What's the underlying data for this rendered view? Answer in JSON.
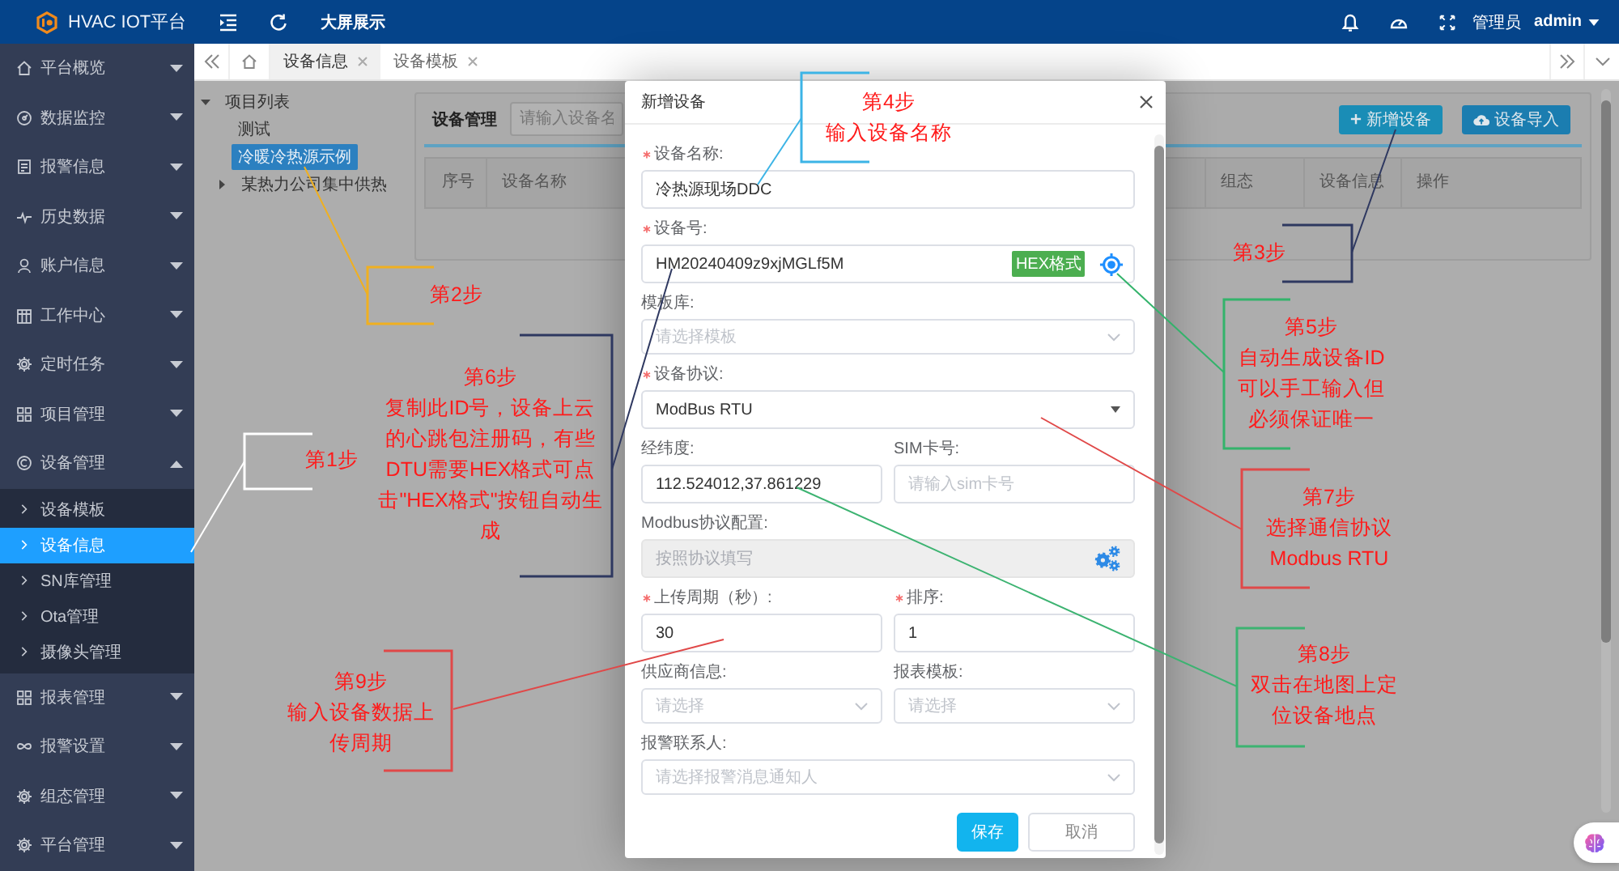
{
  "header": {
    "title": "HVAC IOT平台",
    "link": "大屏展示",
    "role": "管理员",
    "user": "admin"
  },
  "sidebar": {
    "items": [
      {
        "label": "平台概览",
        "expanded": false
      },
      {
        "label": "数据监控",
        "expanded": false
      },
      {
        "label": "报警信息",
        "expanded": false
      },
      {
        "label": "历史数据",
        "expanded": false
      },
      {
        "label": "账户信息",
        "expanded": false
      },
      {
        "label": "工作中心",
        "expanded": false
      },
      {
        "label": "定时任务",
        "expanded": false
      },
      {
        "label": "项目管理",
        "expanded": false
      },
      {
        "label": "设备管理",
        "expanded": true,
        "children": [
          {
            "label": "设备模板",
            "selected": false
          },
          {
            "label": "设备信息",
            "selected": true
          },
          {
            "label": "SN库管理",
            "selected": false
          },
          {
            "label": "Ota管理",
            "selected": false
          },
          {
            "label": "摄像头管理",
            "selected": false
          }
        ]
      },
      {
        "label": "报表管理",
        "expanded": false
      },
      {
        "label": "报警设置",
        "expanded": false
      },
      {
        "label": "组态管理",
        "expanded": false
      },
      {
        "label": "平台管理",
        "expanded": false
      }
    ]
  },
  "tabs": [
    {
      "label": "设备信息",
      "selected": true
    },
    {
      "label": "设备模板",
      "selected": false
    }
  ],
  "project_tree": {
    "items": [
      {
        "label": "项目列表",
        "kind": "folder",
        "expanded": true,
        "selected": false,
        "children": [
          {
            "label": "测试",
            "kind": "leaf",
            "selected": false
          },
          {
            "label": "冷暖冷热源示例",
            "kind": "leaf",
            "selected": true
          },
          {
            "label": "某热力公司集中供热",
            "kind": "folder",
            "expanded": false,
            "selected": false
          }
        ]
      }
    ]
  },
  "device_panel": {
    "title": "设备管理",
    "search_placeholder": "请输入设备名",
    "buttons": [
      {
        "label": "新增设备",
        "kind": "add"
      },
      {
        "label": "设备导入",
        "kind": "import"
      }
    ],
    "table": {
      "columns": [
        "序号",
        "设备名称",
        "组态",
        "设备信息",
        "操作"
      ]
    }
  },
  "dialog": {
    "title": "新增设备",
    "rows": [
      {
        "fields": [
          {
            "label": "设备名称:",
            "required": true,
            "kind": "input",
            "value": "冷热源现场DDC"
          }
        ]
      },
      {
        "fields": [
          {
            "label": "设备号:",
            "required": true,
            "kind": "id-input",
            "value": "HM20240409z9xjMGLf5M",
            "badge": "HEX格式"
          }
        ]
      },
      {
        "fields": [
          {
            "label": "模板库:",
            "required": false,
            "kind": "select",
            "placeholder": "请选择模板"
          }
        ]
      },
      {
        "fields": [
          {
            "label": "设备协议:",
            "required": true,
            "kind": "dropdown",
            "value": "ModBus RTU"
          }
        ]
      },
      {
        "fields": [
          {
            "label": "经纬度:",
            "required": false,
            "kind": "input",
            "value": "112.524012,37.861229"
          },
          {
            "label": "SIM卡号:",
            "required": false,
            "kind": "input",
            "placeholder": "请输入sim卡号"
          }
        ]
      },
      {
        "fields": [
          {
            "label": "Modbus协议配置:",
            "required": false,
            "kind": "config",
            "placeholder": "按照协议填写"
          }
        ]
      },
      {
        "fields": [
          {
            "label": "上传周期（秒）:",
            "required": true,
            "kind": "input",
            "value": "30"
          },
          {
            "label": "排序:",
            "required": true,
            "kind": "input",
            "value": "1"
          }
        ]
      },
      {
        "fields": [
          {
            "label": "供应商信息:",
            "required": false,
            "kind": "select",
            "placeholder": "请选择"
          },
          {
            "label": "报表模板:",
            "required": false,
            "kind": "select",
            "placeholder": "请选择"
          }
        ]
      },
      {
        "fields": [
          {
            "label": "报警联系人:",
            "required": false,
            "kind": "select",
            "placeholder": "请选择报警消息通知人"
          }
        ]
      }
    ],
    "buttons": [
      {
        "label": "保存",
        "kind": "primary"
      },
      {
        "label": "取消",
        "kind": "default"
      }
    ]
  },
  "annotations": [
    {
      "step": "第1步",
      "color": "#ffffff"
    },
    {
      "step": "第2步",
      "color": "#f0b020"
    },
    {
      "step": "第3步",
      "color": "#2e3860"
    },
    {
      "step": "第4步",
      "lines": [
        "输入设备名称"
      ],
      "color": "#3cb4e6"
    },
    {
      "step": "第5步",
      "lines": [
        "自动生成设备ID",
        "可以手工输入但",
        "必须保证唯一"
      ],
      "color": "#33b36b"
    },
    {
      "step": "第6步",
      "lines": [
        "复制此ID号，设备上云",
        "的心跳包注册码，有些",
        "DTU需要HEX格式可点",
        "击\"HEX格式\"按钮自动生",
        "成"
      ],
      "color": "#2e3860"
    },
    {
      "step": "第7步",
      "lines": [
        "选择通信协议",
        "Modbus RTU"
      ],
      "color": "#e04848"
    },
    {
      "step": "第8步",
      "lines": [
        "双击在地图上定",
        "位设备地点"
      ],
      "color": "#3cb371"
    },
    {
      "step": "第9步",
      "lines": [
        "输入设备数据上",
        "传周期"
      ],
      "color": "#e04848"
    }
  ]
}
